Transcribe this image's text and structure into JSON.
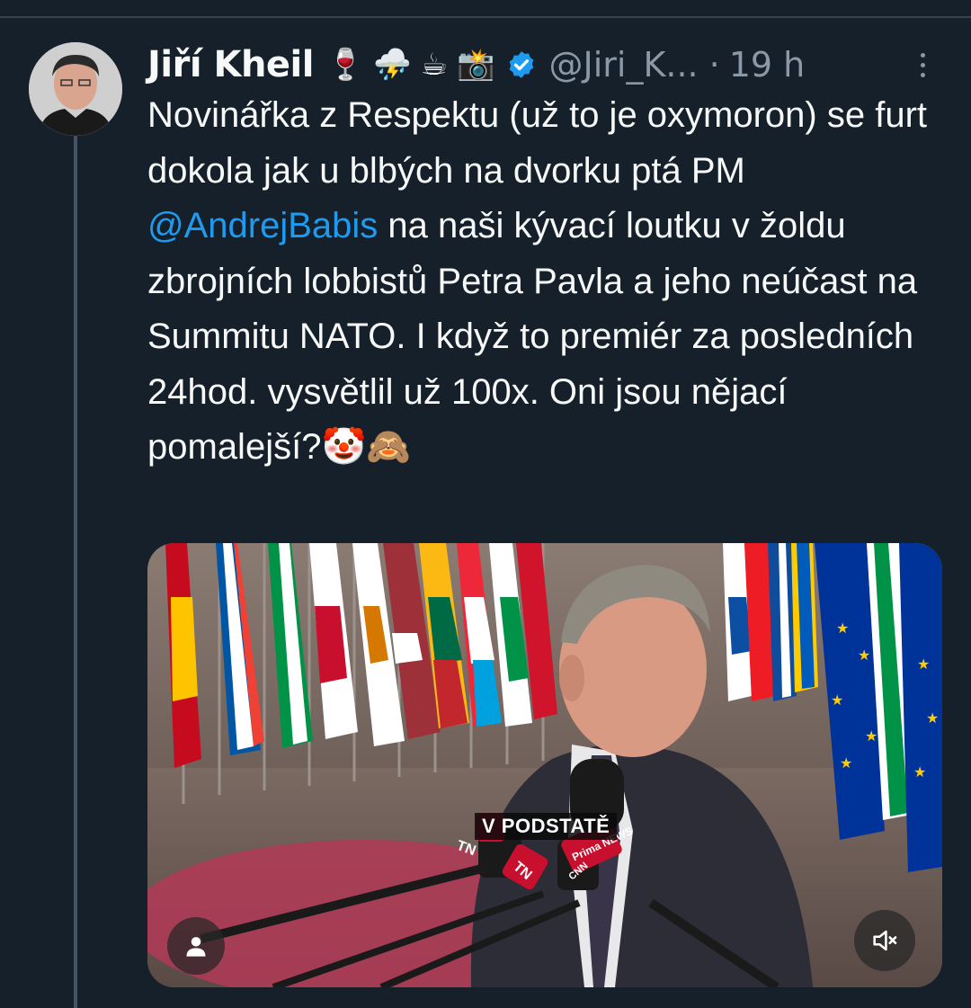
{
  "tweet": {
    "author": {
      "name": "Jiří Kheil",
      "emojis": [
        "🍷",
        "⛈️",
        "☕",
        "📸"
      ],
      "handle": "@Jiri_K...",
      "separator": "·",
      "time": "19 h",
      "verified": true
    },
    "text": {
      "part1": "Novinářka z Respektu (už to je oxymoron) se furt dokola jak u blbých na dvorku ptá PM ",
      "mention": "@AndrejBabis",
      "part2": " na naši kývací loutku v žoldu zbrojních lobbistů Petra Pavla a jeho neúčast na Summitu NATO. I když to premiér za posledních 24hod. vysvětlil už 100x. Oni jsou nějací pomalejší?",
      "trailing_emojis": "🤡🙈"
    },
    "media": {
      "caption": "V PODSTATĚ",
      "mic_labels": [
        "TN",
        "TN",
        "Prima NEWS",
        "CNN"
      ]
    }
  },
  "colors": {
    "background": "#15202b",
    "text": "#f7f9f9",
    "secondary": "#8b98a5",
    "link": "#1d9bf0",
    "verified": "#1d9bf0"
  }
}
